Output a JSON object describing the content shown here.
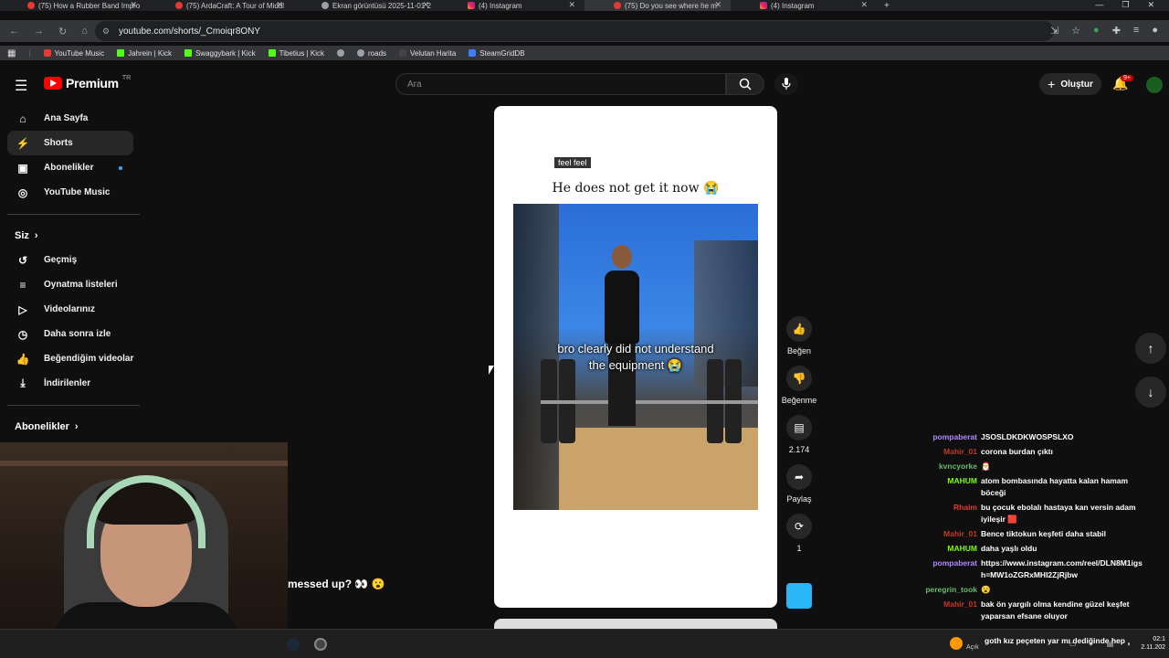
{
  "browser": {
    "tabs": [
      {
        "title": "(75) How a Rubber Band Impro",
        "icon": "youtube"
      },
      {
        "title": "(75) ArdaCraft: A Tour of Middl",
        "icon": "youtube"
      },
      {
        "title": "Ekran görüntüsü 2025-11-01 2",
        "icon": "globe"
      },
      {
        "title": "(4) Instagram",
        "icon": "instagram"
      },
      {
        "title": "(75) Do you see where he m",
        "icon": "youtube"
      },
      {
        "title": "(4) Instagram",
        "icon": "instagram"
      }
    ],
    "url": "youtube.com/shorts/_Cmoiqr8ONY",
    "bookmarks": [
      "YouTube Music",
      "Jahrein | Kick",
      "Swaggybark | Kick",
      "Tibetius | Kick",
      "roads",
      "Velutan Harita",
      "SteamGridDB"
    ]
  },
  "header": {
    "logo_text": "Premium",
    "country": "TR",
    "search_placeholder": "Ara",
    "create_label": "Oluştur",
    "notif_count": "9+"
  },
  "sidebar": {
    "main": [
      {
        "label": "Ana Sayfa",
        "icon": "home-icon"
      },
      {
        "label": "Shorts",
        "icon": "shorts-icon"
      },
      {
        "label": "Abonelikler",
        "icon": "subscriptions-icon"
      },
      {
        "label": "YouTube Music",
        "icon": "music-icon"
      }
    ],
    "you_section": "Siz",
    "you": [
      {
        "label": "Geçmiş",
        "icon": "history-icon"
      },
      {
        "label": "Oynatma listeleri",
        "icon": "playlist-icon"
      },
      {
        "label": "Videolarınız",
        "icon": "video-icon"
      },
      {
        "label": "Daha sonra izle",
        "icon": "clock-icon"
      },
      {
        "label": "Beğendiğim videolar",
        "icon": "like-icon"
      },
      {
        "label": "İndirilenler",
        "icon": "download-icon"
      }
    ],
    "subs_section": "Abonelikler"
  },
  "short": {
    "tag": "feel feel",
    "title": "He does not get it now 😭",
    "caption_line1": "bro clearly did not understand",
    "caption_line2": "the equipment 😭"
  },
  "actions": {
    "like": "Beğen",
    "dislike": "Beğenme",
    "comments": "2.174",
    "share": "Paylaş",
    "remix": "1"
  },
  "stream_overlay_text": "messed up? 👀 😮",
  "chat": [
    {
      "user": "pompaberat",
      "color": "#b388ff",
      "text": "JSOSLDKDKWOSPSLXO"
    },
    {
      "user": "Mahir_01",
      "color": "#c0392b",
      "text": "corona burdan çıktı"
    },
    {
      "user": "kvncyorke",
      "color": "#66bb6a",
      "text": "🎅"
    },
    {
      "user": "MAHUM",
      "color": "#7cfc00",
      "text": "atom bombasında hayatta kalan hamam böceği"
    },
    {
      "user": "Rhaim",
      "color": "#e53935",
      "text": "bu çocuk ebolalı hastaya kan versin adam iyileşir 🟥"
    },
    {
      "user": "Mahir_01",
      "color": "#c0392b",
      "text": "Bence tiktokun keşfeti daha stabil"
    },
    {
      "user": "MAHUM",
      "color": "#7cfc00",
      "text": "daha yaşlı oldu"
    },
    {
      "user": "pompaberat",
      "color": "#b388ff",
      "text": "https://www.instagram.com/reel/DLN8M1igsh=MW1oZGRxMHI2ZjRjbw"
    },
    {
      "user": "peregrin_took",
      "color": "#66bb6a",
      "text": "😮"
    },
    {
      "user": "Mahir_01",
      "color": "#c0392b",
      "text": "bak ön yargılı olma kendine güzel keşfet yaparsan efsane oluyor"
    },
    {
      "user": "",
      "color": "#c0392b",
      "text": "goth kız peçeten yar mı dediğinde hep"
    }
  ],
  "taskbar": {
    "weather": "Açık",
    "time": "02:1",
    "date": "2.11.202"
  }
}
